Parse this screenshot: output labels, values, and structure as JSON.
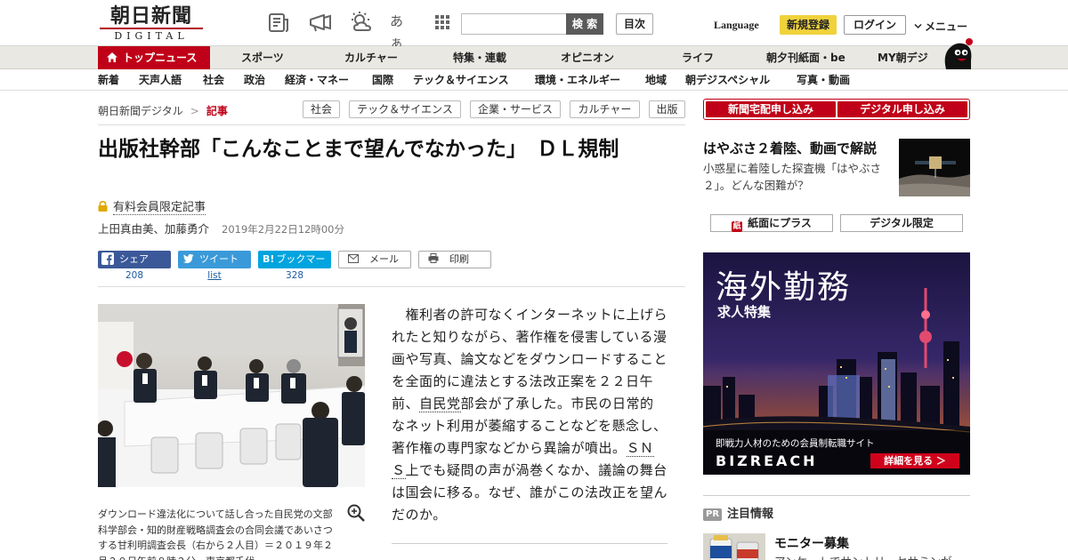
{
  "header": {
    "logo_main": "朝日新聞",
    "logo_sub": "DIGITAL",
    "search_button": "検 索",
    "toc_button": "目次",
    "kana_icon_text": "あぁ",
    "language": "Language",
    "register": "新規登録",
    "login": "ログイン",
    "menu": "メニュー"
  },
  "nav_primary": {
    "active": "トップニュース",
    "items": [
      "スポーツ",
      "カルチャー",
      "特集・連載",
      "オピニオン",
      "ライフ",
      "朝夕刊紙面・be",
      "MY朝デジ"
    ]
  },
  "nav_secondary": {
    "items": [
      "新着",
      "天声人語",
      "社会",
      "政治",
      "経済・マネー",
      "国際",
      "テック＆サイエンス",
      "環境・エネルギー",
      "地域",
      "朝デジスペシャル",
      "写真・動画"
    ]
  },
  "breadcrumb": {
    "home": "朝日新聞デジタル",
    "separator": ">",
    "current": "記事"
  },
  "tags": [
    "社会",
    "テック＆サイエンス",
    "企業・サービス",
    "カルチャー",
    "出版"
  ],
  "article": {
    "title": "出版社幹部「こんなことまで望んでなかった」　ＤＬ規制",
    "paid_label": "有料会員限定記事",
    "authors": "上田真由美、加藤勇介",
    "datetime": "2019年2月22日12時00分",
    "share": {
      "facebook": "シェア",
      "twitter": "ツイート",
      "hatena": "ブックマーク",
      "hatena_prefix": "B!",
      "mail": "メール",
      "print": "印刷",
      "facebook_count": "208",
      "twitter_count": "list",
      "hatena_count": "328"
    },
    "caption": "ダウンロード違法化について話し合った自民党の文部科学部会・知的財産戦略調査会の合同会議であいさつする甘利明調査会長（右から２人目）＝２０１９年２月２０日午前８時２分、東京都千代",
    "body_1": "　権利者の許可なくインターネットに上げられたと知りながら、著作権を侵害している漫画や写真、論文などをダウンロードすることを全面的に違法とする法改正案を２２日午前、",
    "body_link1": "自民党",
    "body_2": "部会が了承した。市民の日常的なネット利用が萎縮することなどを懸念し、著作権の専門家などから異論が噴出。",
    "body_link2": "ＳＮＳ",
    "body_3": "上でも疑問の声が渦巻くなか、議論の舞台は国会に移る。なぜ、誰がこの法改正を望んだのか。"
  },
  "sidebar": {
    "btn_paper": "新聞宅配申し込み",
    "btn_digital": "デジタル申し込み",
    "feature_title": "はやぶさ２着陸、動画で解説",
    "feature_desc": "小惑星に着陸した探査機「はやぶさ２」。どんな困難が？",
    "plus_icon_text": "紙",
    "btn_plus": "紙面にプラス",
    "btn_limited": "デジタル限定",
    "ad": {
      "title": "海外勤務",
      "subtitle": "求人特集",
      "tagline": "即戦力人材のための会員制転職サイト",
      "brand": "BIZREACH",
      "cta": "詳細を見る ＞"
    },
    "pr_badge": "PR",
    "pr_label": "注目情報",
    "pr_item_title": "モニター募集",
    "pr_item_desc": "アンケートでサントリーセサミンが"
  }
}
